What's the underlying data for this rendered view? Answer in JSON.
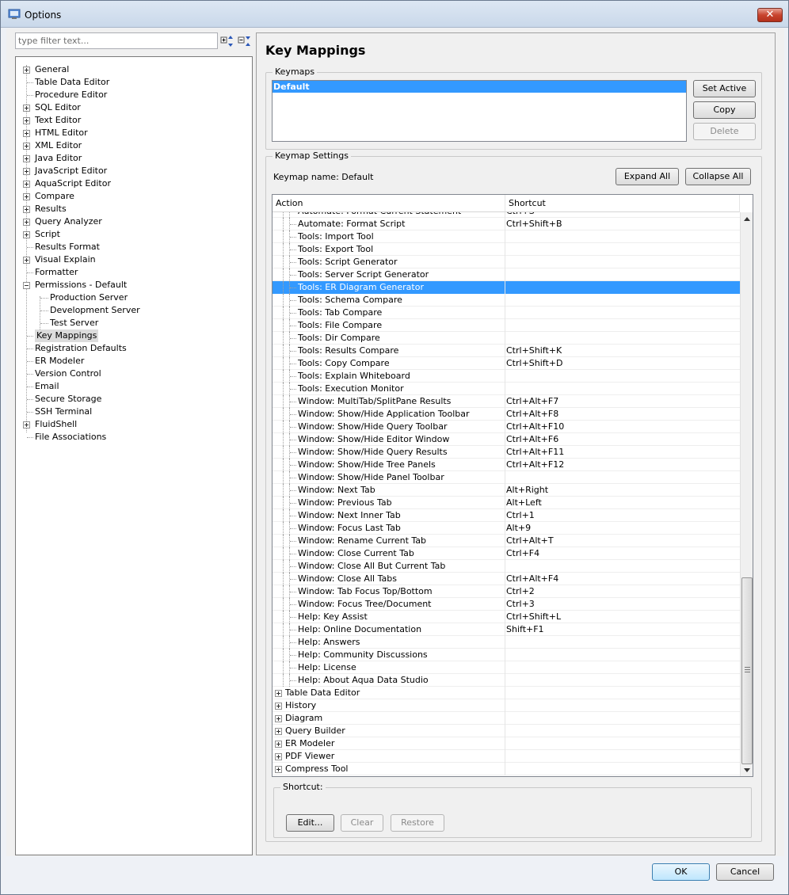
{
  "window": {
    "title": "Options",
    "close_glyph": "✕"
  },
  "filter": {
    "placeholder": "type filter text..."
  },
  "tree": [
    {
      "label": "General",
      "exp": "plus"
    },
    {
      "label": "Table Data Editor",
      "exp": ""
    },
    {
      "label": "Procedure Editor",
      "exp": ""
    },
    {
      "label": "SQL Editor",
      "exp": "plus"
    },
    {
      "label": "Text Editor",
      "exp": "plus"
    },
    {
      "label": "HTML Editor",
      "exp": "plus"
    },
    {
      "label": "XML Editor",
      "exp": "plus"
    },
    {
      "label": "Java Editor",
      "exp": "plus"
    },
    {
      "label": "JavaScript Editor",
      "exp": "plus"
    },
    {
      "label": "AquaScript Editor",
      "exp": "plus"
    },
    {
      "label": "Compare",
      "exp": "plus"
    },
    {
      "label": "Results",
      "exp": "plus"
    },
    {
      "label": "Query Analyzer",
      "exp": "plus"
    },
    {
      "label": "Script",
      "exp": "plus"
    },
    {
      "label": "Results Format",
      "exp": ""
    },
    {
      "label": "Visual Explain",
      "exp": "plus"
    },
    {
      "label": "Formatter",
      "exp": ""
    },
    {
      "label": "Permissions - Default",
      "exp": "minus"
    },
    {
      "label": "Production Server",
      "exp": "",
      "child": true
    },
    {
      "label": "Development Server",
      "exp": "",
      "child": true
    },
    {
      "label": "Test Server",
      "exp": "",
      "child": true
    },
    {
      "label": "Key Mappings",
      "exp": "",
      "selected": true
    },
    {
      "label": "Registration Defaults",
      "exp": ""
    },
    {
      "label": "ER Modeler",
      "exp": ""
    },
    {
      "label": "Version Control",
      "exp": ""
    },
    {
      "label": "Email",
      "exp": ""
    },
    {
      "label": "Secure Storage",
      "exp": ""
    },
    {
      "label": "SSH Terminal",
      "exp": ""
    },
    {
      "label": "FluidShell",
      "exp": "plus"
    },
    {
      "label": "File Associations",
      "exp": ""
    }
  ],
  "page": {
    "title": "Key Mappings"
  },
  "keymaps": {
    "legend": "Keymaps",
    "items": [
      "Default"
    ],
    "set_active": "Set Active",
    "copy": "Copy",
    "delete": "Delete"
  },
  "settings": {
    "legend": "Keymap Settings",
    "name_label": "Keymap name: Default",
    "expand_all": "Expand All",
    "collapse_all": "Collapse All",
    "col_action": "Action",
    "col_shortcut": "Shortcut"
  },
  "rows": [
    {
      "action": "Automate: Format Current Statement",
      "shortcut": "Ctrl+S"
    },
    {
      "action": "Automate: Format Script",
      "shortcut": "Ctrl+Shift+B"
    },
    {
      "action": "Tools: Import Tool",
      "shortcut": ""
    },
    {
      "action": "Tools: Export Tool",
      "shortcut": ""
    },
    {
      "action": "Tools: Script Generator",
      "shortcut": ""
    },
    {
      "action": "Tools: Server Script Generator",
      "shortcut": ""
    },
    {
      "action": "Tools: ER Diagram Generator",
      "shortcut": "",
      "selected": true
    },
    {
      "action": "Tools: Schema Compare",
      "shortcut": ""
    },
    {
      "action": "Tools: Tab Compare",
      "shortcut": ""
    },
    {
      "action": "Tools: File Compare",
      "shortcut": ""
    },
    {
      "action": "Tools: Dir Compare",
      "shortcut": ""
    },
    {
      "action": "Tools: Results Compare",
      "shortcut": "Ctrl+Shift+K"
    },
    {
      "action": "Tools: Copy Compare",
      "shortcut": "Ctrl+Shift+D"
    },
    {
      "action": "Tools: Explain Whiteboard",
      "shortcut": ""
    },
    {
      "action": "Tools: Execution Monitor",
      "shortcut": ""
    },
    {
      "action": "Window: MultiTab/SplitPane Results",
      "shortcut": "Ctrl+Alt+F7"
    },
    {
      "action": "Window: Show/Hide Application Toolbar",
      "shortcut": "Ctrl+Alt+F8"
    },
    {
      "action": "Window: Show/Hide Query Toolbar",
      "shortcut": "Ctrl+Alt+F10"
    },
    {
      "action": "Window: Show/Hide Editor Window",
      "shortcut": "Ctrl+Alt+F6"
    },
    {
      "action": "Window: Show/Hide Query Results",
      "shortcut": "Ctrl+Alt+F11"
    },
    {
      "action": "Window: Show/Hide Tree Panels",
      "shortcut": "Ctrl+Alt+F12"
    },
    {
      "action": "Window: Show/Hide Panel Toolbar",
      "shortcut": ""
    },
    {
      "action": "Window: Next Tab",
      "shortcut": "Alt+Right"
    },
    {
      "action": "Window: Previous Tab",
      "shortcut": "Alt+Left"
    },
    {
      "action": "Window: Next Inner Tab",
      "shortcut": "Ctrl+1"
    },
    {
      "action": "Window: Focus Last Tab",
      "shortcut": "Alt+9"
    },
    {
      "action": "Window: Rename Current Tab",
      "shortcut": "Ctrl+Alt+T"
    },
    {
      "action": "Window: Close Current Tab",
      "shortcut": "Ctrl+F4"
    },
    {
      "action": "Window: Close All But Current Tab",
      "shortcut": ""
    },
    {
      "action": "Window: Close All Tabs",
      "shortcut": "Ctrl+Alt+F4"
    },
    {
      "action": "Window: Tab Focus Top/Bottom",
      "shortcut": "Ctrl+2"
    },
    {
      "action": "Window: Focus Tree/Document",
      "shortcut": "Ctrl+3"
    },
    {
      "action": "Help: Key Assist",
      "shortcut": "Ctrl+Shift+L"
    },
    {
      "action": "Help: Online Documentation",
      "shortcut": "Shift+F1"
    },
    {
      "action": "Help: Answers",
      "shortcut": ""
    },
    {
      "action": "Help: Community Discussions",
      "shortcut": ""
    },
    {
      "action": "Help: License",
      "shortcut": ""
    },
    {
      "action": "Help: About Aqua Data Studio",
      "shortcut": ""
    },
    {
      "action": "Table Data Editor",
      "shortcut": "",
      "group": true
    },
    {
      "action": "History",
      "shortcut": "",
      "group": true
    },
    {
      "action": "Diagram",
      "shortcut": "",
      "group": true
    },
    {
      "action": "Query Builder",
      "shortcut": "",
      "group": true
    },
    {
      "action": "ER Modeler",
      "shortcut": "",
      "group": true
    },
    {
      "action": "PDF Viewer",
      "shortcut": "",
      "group": true
    },
    {
      "action": "Compress Tool",
      "shortcut": "",
      "group": true
    }
  ],
  "shortcut_box": {
    "legend": "Shortcut:",
    "edit": "Edit...",
    "clear": "Clear",
    "restore": "Restore"
  },
  "footer": {
    "ok": "OK",
    "cancel": "Cancel"
  }
}
